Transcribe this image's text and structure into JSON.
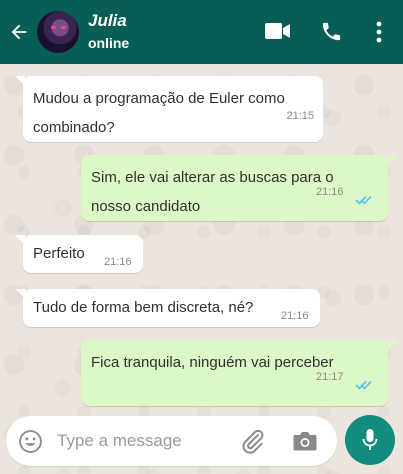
{
  "header": {
    "contact_name": "Julia",
    "status": "online",
    "icons": [
      "back-arrow-icon",
      "video-call-icon",
      "phone-icon",
      "more-menu-icon"
    ]
  },
  "messages": [
    {
      "direction": "in",
      "lines": [
        "Mudou a programação de Euler como",
        "combinado?"
      ],
      "time": "21:15"
    },
    {
      "direction": "out",
      "lines": [
        "Sim, ele vai alterar as buscas para o",
        "nosso candidato"
      ],
      "time": "21:16",
      "read": true
    },
    {
      "direction": "in",
      "lines": [
        "Perfeito"
      ],
      "time": "21:16"
    },
    {
      "direction": "in",
      "lines": [
        "Tudo de forma bem discreta, né?"
      ],
      "time": "21:16"
    },
    {
      "direction": "out",
      "lines": [
        "Fica tranquila, ninguém vai perceber"
      ],
      "time": "21:17",
      "read": true
    }
  ],
  "composer": {
    "placeholder": "Type a message",
    "icons": [
      "emoji-icon",
      "attach-icon",
      "camera-icon",
      "mic-icon"
    ]
  },
  "colors": {
    "header": "#075e54",
    "outgoing_bubble": "#dcf8c6",
    "incoming_bubble": "#ffffff",
    "read_ticks": "#4fc3f7",
    "mic_button": "#128c7e"
  }
}
